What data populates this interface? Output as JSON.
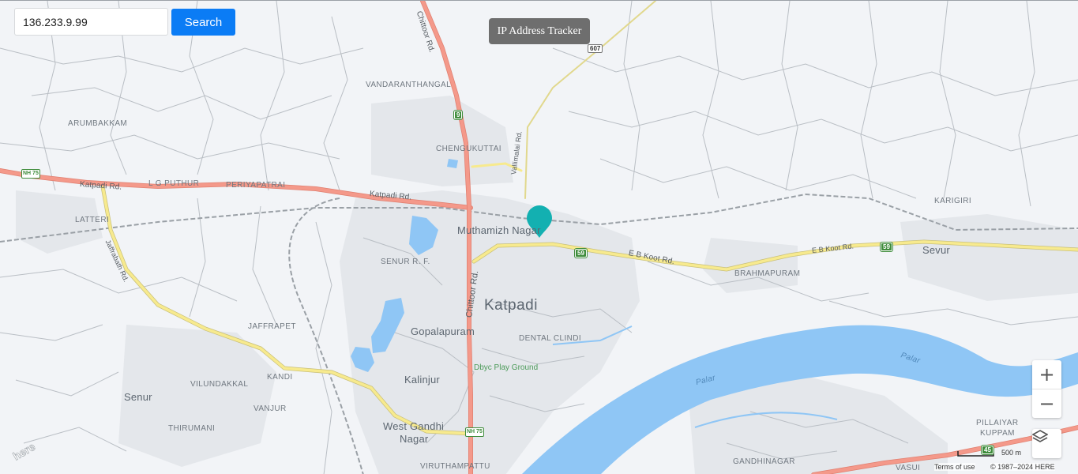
{
  "search": {
    "value": "136.233.9.99",
    "button_label": "Search"
  },
  "app_title": "IP Address Tracker",
  "map": {
    "places": {
      "vandaranthangal": "VANDARANTHANGAL",
      "arumbakkam": "ARUMBAKKAM",
      "chengukuttai": "CHENGUKUTTAI",
      "l_g_puthur": "L G PUTHUR",
      "periyapatrai": "PERIYAPATRAI",
      "latteri": "LATTERI",
      "senur_r_f": "SENUR R. F.",
      "muthamizh_nagar": "Muthamizh Nagar",
      "katpadi": "Katpadi",
      "gopalapuram": "Gopalapuram",
      "dental_clindi": "DENTAL CLINDI",
      "dbyc_play_ground": "Dbyc Play Ground",
      "kalinjur": "Kalinjur",
      "jaffrapet": "JAFFRAPET",
      "kandi": "KANDI",
      "vilundakkal": "VILUNDAKKAL",
      "vanjur": "VANJUR",
      "senur": "Senur",
      "thirumani": "THIRUMANI",
      "west_gandhi_nagar_1": "West Gandhi",
      "west_gandhi_nagar_2": "Nagar",
      "viruthampattu": "VIRUTHAMPATTU",
      "karigiri": "KARIGIRI",
      "brahmapuram": "BRAHMAPURAM",
      "sevur": "Sevur",
      "gandhinagar": "GANDHINAGAR",
      "pillaiyar_kuppam_1": "PILLAIYAR",
      "pillaiyar_kuppam_2": "KUPPAM",
      "vasui": "VASUI",
      "palar_1": "Palar",
      "palar_2": "Palar"
    },
    "roads": {
      "chittoor_rd_north": "Chittoor Rd.",
      "chittoor_rd_south": "Chittoor Rd.",
      "katpadi_rd_west": "Katpadi Rd.",
      "katpadi_rd_east": "Katpadi Rd.",
      "vallimalai_rd": "Vallimalai Rd.",
      "jaffrabath_rd": "Jaffrabath Rd.",
      "e_b_koot_rd_1": "E B Koot Rd.",
      "e_b_koot_rd_2": "E B Koot Rd."
    },
    "shields": {
      "nh75_west": "NH 75",
      "nh75_south": "NH 75",
      "r9": "9",
      "r59_a": "59",
      "r59_b": "59",
      "r45": "45",
      "r607": "607"
    },
    "logo_text": "here",
    "zoom_in": "+",
    "zoom_out": "−",
    "scale": "500 m",
    "terms": "Terms of use",
    "copyright": "© 1987–2024 HERE"
  },
  "colors": {
    "background": "#f2f4f7",
    "water": "#8fc6f5",
    "major_road": "#f4998a",
    "secondary_road": "#f7ea8e",
    "marker": "#13b0b1",
    "search_button": "#0b7cf5"
  }
}
